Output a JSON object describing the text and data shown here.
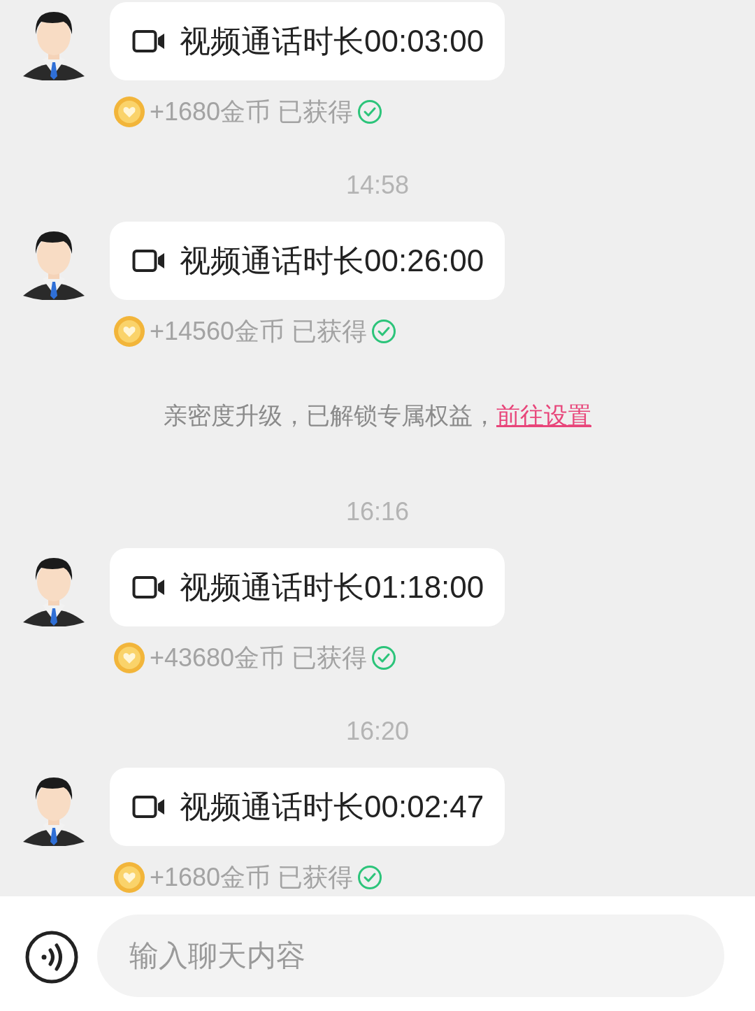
{
  "messages": [
    {
      "kind": "call",
      "text": "视频通话时长00:03:00",
      "reward": "+1680金币 已获得",
      "earned": true
    },
    {
      "kind": "time",
      "text": "14:58"
    },
    {
      "kind": "call",
      "text": "视频通话时长00:26:00",
      "reward": "+14560金币 已获得",
      "earned": true
    },
    {
      "kind": "notice",
      "text": "亲密度升级，已解锁专属权益，",
      "link": "前往设置"
    },
    {
      "kind": "time",
      "text": "16:16"
    },
    {
      "kind": "call",
      "text": "视频通话时长01:18:00",
      "reward": "+43680金币 已获得",
      "earned": true
    },
    {
      "kind": "time",
      "text": "16:20"
    },
    {
      "kind": "call",
      "text": "视频通话时长00:02:47",
      "reward": "+1680金币 已获得",
      "earned": true
    }
  ],
  "input": {
    "placeholder": "输入聊天内容"
  }
}
